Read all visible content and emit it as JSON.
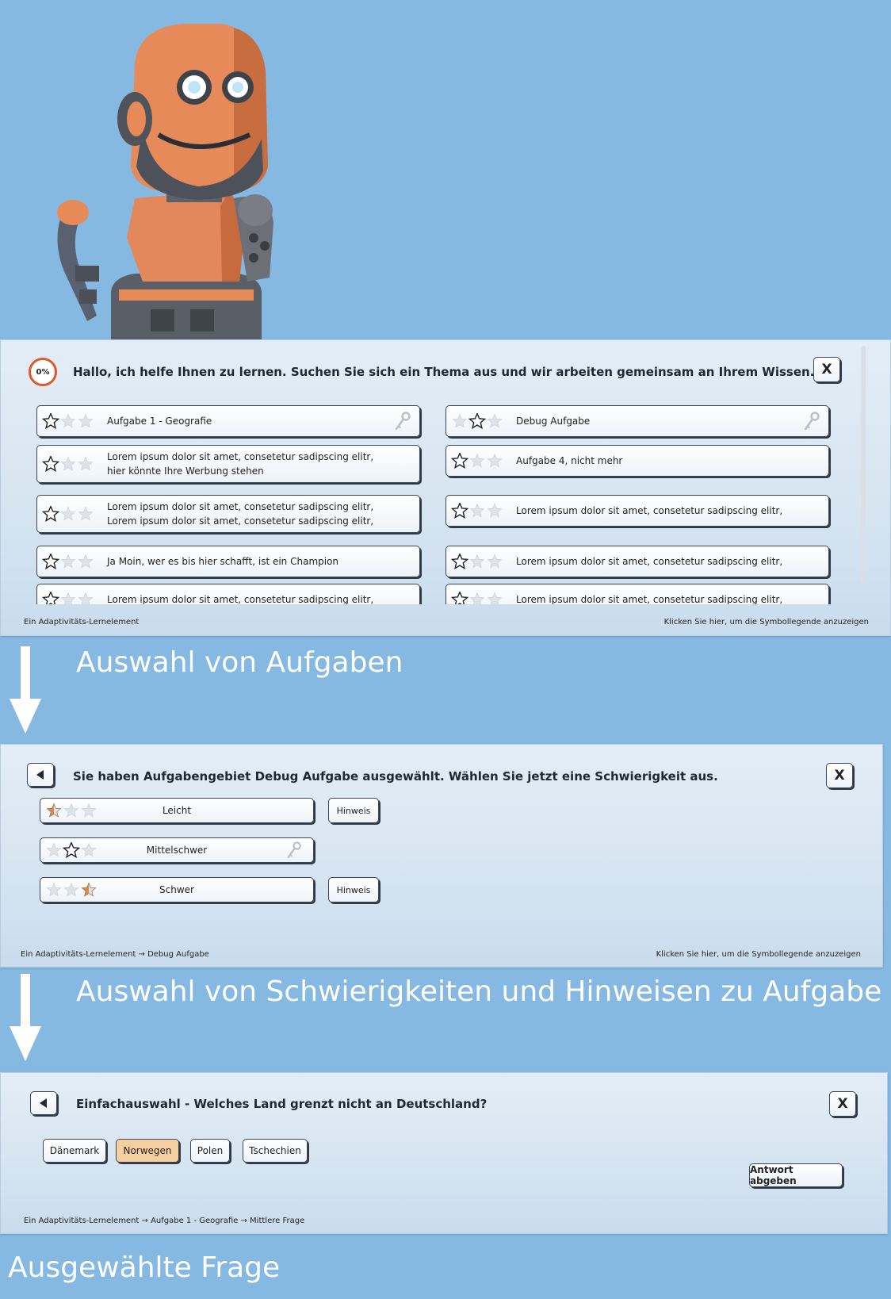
{
  "colors": {
    "background": "#86b9e2",
    "accent_orange": "#e0582a",
    "selected_answer": "#f5cf9f",
    "button_border": "#3a4656"
  },
  "robot": {
    "icon": "robot-mascot-icon"
  },
  "panel1": {
    "progress": "0%",
    "header": "Hallo, ich helfe Ihnen zu lernen. Suchen Sie sich ein Thema aus und wir arbeiten gemeinsam an Ihrem Wissen.",
    "close": "X",
    "tasks_left": [
      {
        "lines": [
          "Aufgabe 1 - Geografie"
        ],
        "stars": 1,
        "key": true
      },
      {
        "lines": [
          "Lorem ipsum dolor sit amet, consetetur sadipscing elitr,",
          "hier könnte Ihre Werbung stehen"
        ],
        "stars": 0,
        "key": false
      },
      {
        "lines": [
          "Lorem ipsum dolor sit amet, consetetur sadipscing elitr,",
          "Lorem ipsum dolor sit amet, consetetur sadipscing elitr,"
        ],
        "stars": 0,
        "key": false
      },
      {
        "lines": [
          "Ja Moin, wer es bis hier schafft, ist ein Champion"
        ],
        "stars": 0,
        "key": false
      },
      {
        "lines": [
          "Lorem ipsum dolor sit amet, consetetur sadipscing elitr,"
        ],
        "stars": 0,
        "key": false
      }
    ],
    "tasks_right": [
      {
        "lines": [
          "Debug Aufgabe"
        ],
        "stars": 2,
        "key": true
      },
      {
        "lines": [
          "Aufgabe 4, nicht mehr"
        ],
        "stars": 0,
        "key": false
      },
      {
        "lines": [
          "Lorem ipsum dolor sit amet, consetetur sadipscing elitr,"
        ],
        "stars": 0,
        "key": false
      },
      {
        "lines": [
          "Lorem ipsum dolor sit amet, consetetur sadipscing elitr,"
        ],
        "stars": 0,
        "key": false
      },
      {
        "lines": [
          "Lorem ipsum dolor sit amet, consetetur sadipscing elitr,"
        ],
        "stars": 0,
        "key": false
      }
    ],
    "footer_left": "Ein Adaptivitäts-Lernelement",
    "footer_right": "Klicken Sie hier, um die Symbollegende anzuzeigen"
  },
  "caption1": "Auswahl von Aufgaben",
  "panel2": {
    "back_icon": "back-arrow-icon",
    "header": "Sie haben Aufgabengebiet Debug Aufgabe ausgewählt. Wählen Sie jetzt eine Schwierigkeit aus.",
    "close": "X",
    "difficulties": [
      {
        "label": "Leicht",
        "hint": "Hinweis",
        "star_state": "half-first",
        "key": false
      },
      {
        "label": "Mittelschwer",
        "hint": "",
        "star_state": "outline-second",
        "key": true
      },
      {
        "label": "Schwer",
        "hint": "Hinweis",
        "star_state": "half-third",
        "key": false
      }
    ],
    "footer_left": "Ein Adaptivitäts-Lernelement → Debug Aufgabe",
    "footer_right": "Klicken Sie hier, um die Symbollegende anzuzeigen"
  },
  "caption2": "Auswahl von Schwierigkeiten und Hinweisen zu Aufgabe",
  "panel3": {
    "back_icon": "back-arrow-icon",
    "header": "Einfachauswahl - Welches Land grenzt nicht an Deutschland?",
    "close": "X",
    "answers": [
      {
        "label": "Dänemark",
        "selected": false
      },
      {
        "label": "Norwegen",
        "selected": true
      },
      {
        "label": "Polen",
        "selected": false
      },
      {
        "label": "Tschechien",
        "selected": false
      }
    ],
    "submit": "Antwort abgeben",
    "footer_left": "Ein Adaptivitäts-Lernelement → Aufgabe 1 - Geografie → Mittlere Frage"
  },
  "caption3": "Ausgewählte Frage"
}
